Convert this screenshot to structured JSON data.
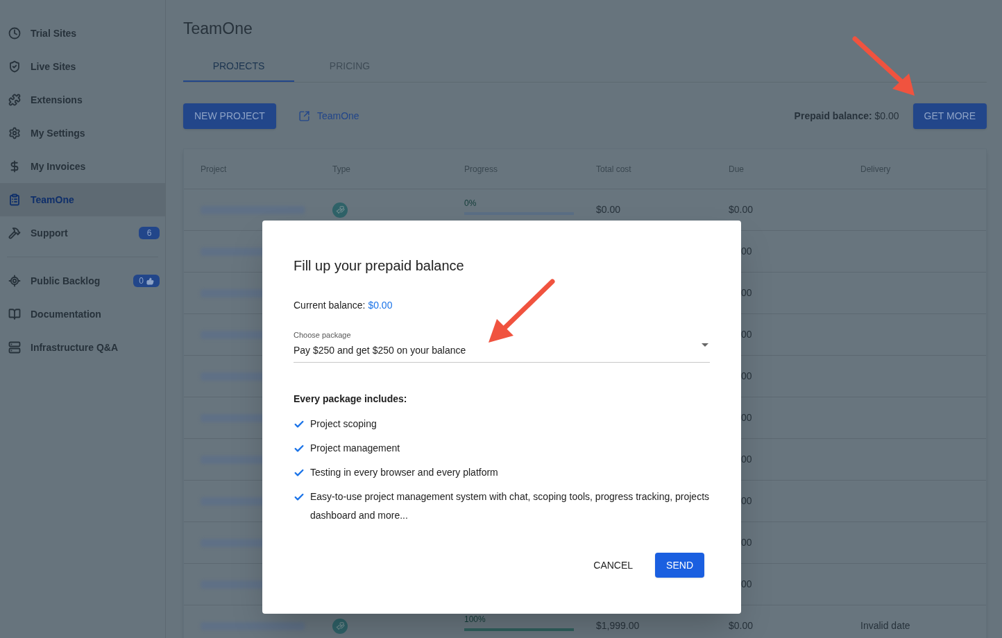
{
  "sidebar": {
    "groups": [
      [
        {
          "label": "Trial Sites",
          "selected": false
        },
        {
          "label": "Live Sites",
          "selected": false
        },
        {
          "label": "Extensions",
          "selected": false
        },
        {
          "label": "My Settings",
          "selected": false
        },
        {
          "label": "My Invoices",
          "selected": false
        },
        {
          "label": "TeamOne",
          "selected": true
        },
        {
          "label": "Support",
          "selected": false,
          "badge": "6"
        }
      ],
      [
        {
          "label": "Public Backlog",
          "selected": false,
          "badge": "0",
          "thumbs_up": true
        },
        {
          "label": "Documentation",
          "selected": false
        },
        {
          "label": "Infrastructure Q&A",
          "selected": false
        }
      ]
    ]
  },
  "page": {
    "title": "TeamOne",
    "tabs": [
      {
        "label": "PROJECTS",
        "selected": true
      },
      {
        "label": "PRICING",
        "selected": false
      }
    ],
    "new_project_button": "NEW PROJECT",
    "team_link": "TeamOne",
    "balance_label": "Prepaid balance:",
    "balance_value": "$0.00",
    "get_more_button": "GET MORE"
  },
  "table": {
    "columns": [
      "Project",
      "Type",
      "Progress",
      "Total cost",
      "Due",
      "Delivery"
    ],
    "rows": [
      {
        "kind": "full",
        "progress": "0%",
        "level": 0,
        "total_cost": "$0.00",
        "due": "$0.00"
      },
      {
        "kind": "covered",
        "due": "00"
      },
      {
        "kind": "covered",
        "due": "00"
      },
      {
        "kind": "covered",
        "due": "00"
      },
      {
        "kind": "covered",
        "due": "00"
      },
      {
        "kind": "covered",
        "due": "00"
      },
      {
        "kind": "covered",
        "due": "00"
      },
      {
        "kind": "covered",
        "due": "00"
      },
      {
        "kind": "covered",
        "due": "00"
      },
      {
        "kind": "covered",
        "due": "00"
      },
      {
        "kind": "full",
        "progress": "100%",
        "level": 1,
        "total_cost": "$1,999.00",
        "due": "$0.00",
        "delivery": "Invalid date"
      }
    ]
  },
  "dialog": {
    "title": "Fill up your prepaid balance",
    "balance_label": "Current balance:",
    "balance_value": "$0.00",
    "select": {
      "label": "Choose package",
      "value": "Pay $250 and get $250 on your balance"
    },
    "includes_heading": "Every package includes:",
    "includes": [
      "Project scoping",
      "Project management",
      "Testing in every browser and every platform",
      "Easy-to-use project management system with chat, scoping tools, progress tracking, projects dashboard and more..."
    ],
    "cancel_button": "CANCEL",
    "send_button": "SEND"
  }
}
